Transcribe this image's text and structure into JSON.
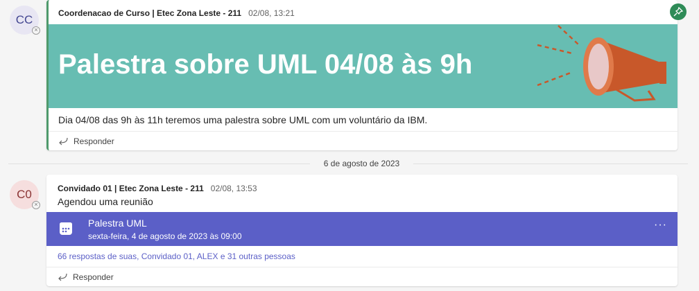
{
  "post1": {
    "avatar_initials": "CC",
    "author": "Coordenacao de Curso | Etec Zona Leste - 211",
    "timestamp": "02/08, 13:21",
    "banner_title": "Palestra sobre UML 04/08 às 9h",
    "body": "Dia 04/08 das 9h às 11h teremos uma palestra sobre UML com um voluntário da IBM.",
    "reply_label": "Responder"
  },
  "date_divider": "6 de agosto de 2023",
  "post2": {
    "avatar_initials": "C0",
    "author": "Convidado 01 | Etec Zona Leste - 211",
    "timestamp": "02/08, 13:53",
    "subtitle": "Agendou uma reunião",
    "meeting_title": "Palestra UML",
    "meeting_date": "sexta-feira, 4 de agosto de 2023 às 09:00",
    "more_label": "···",
    "responses": "66 respostas de suas, Convidado 01, ALEX e 31 outras pessoas",
    "reply_label": "Responder"
  },
  "icons": {
    "pin": "pin-icon",
    "reply": "reply-arrow-icon",
    "calendar": "calendar-icon",
    "megaphone": "megaphone-illustration",
    "presence": "presence-offline-icon"
  },
  "colors": {
    "banner": "#67bdb2",
    "meeting": "#5b5fc7",
    "pin": "#2e8b57",
    "megaphone": "#c8582a"
  }
}
